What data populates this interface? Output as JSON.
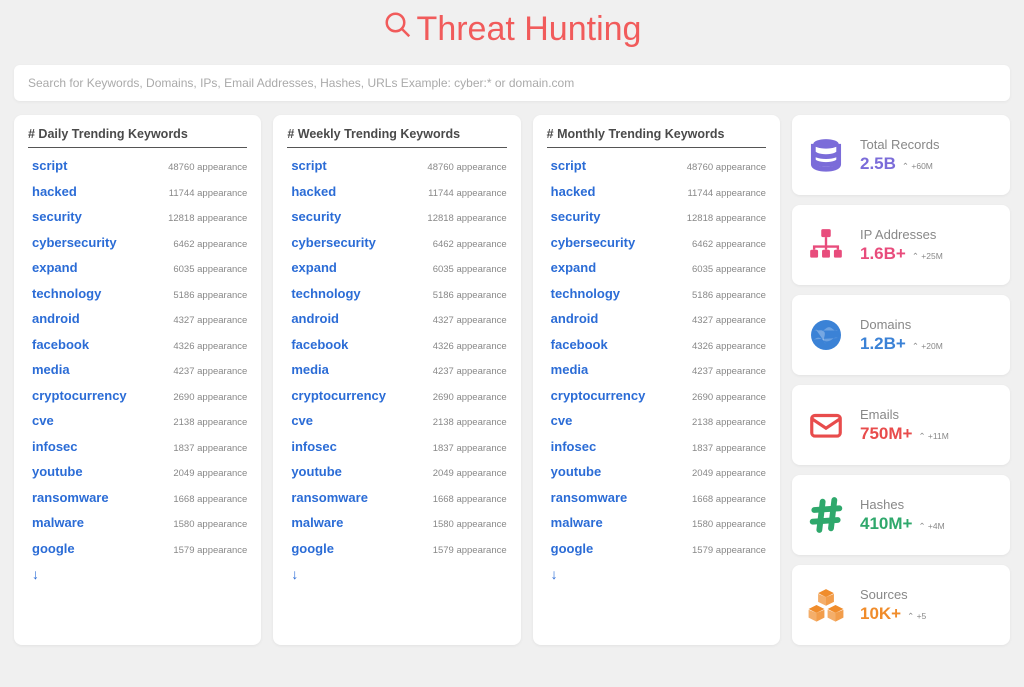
{
  "header": {
    "title": "Threat Hunting"
  },
  "search": {
    "placeholder": "Search for Keywords, Domains, IPs, Email Addresses, Hashes, URLs Example: cyber:* or domain.com"
  },
  "panels": [
    {
      "title": "# Daily Trending Keywords"
    },
    {
      "title": "# Weekly Trending Keywords"
    },
    {
      "title": "# Monthly Trending Keywords"
    }
  ],
  "keywords": [
    {
      "name": "script",
      "count": "48760 appearance"
    },
    {
      "name": "hacked",
      "count": "11744 appearance"
    },
    {
      "name": "security",
      "count": "12818 appearance"
    },
    {
      "name": "cybersecurity",
      "count": "6462 appearance"
    },
    {
      "name": "expand",
      "count": "6035 appearance"
    },
    {
      "name": "technology",
      "count": "5186 appearance"
    },
    {
      "name": "android",
      "count": "4327 appearance"
    },
    {
      "name": "facebook",
      "count": "4326 appearance"
    },
    {
      "name": "media",
      "count": "4237 appearance"
    },
    {
      "name": "cryptocurrency",
      "count": "2690 appearance"
    },
    {
      "name": "cve",
      "count": "2138 appearance"
    },
    {
      "name": "infosec",
      "count": "1837 appearance"
    },
    {
      "name": "youtube",
      "count": "2049 appearance"
    },
    {
      "name": "ransomware",
      "count": "1668 appearance"
    },
    {
      "name": "malware",
      "count": "1580 appearance"
    },
    {
      "name": "google",
      "count": "1579 appearance"
    }
  ],
  "more_arrow": "↓",
  "stats": [
    {
      "label": "Total Records",
      "value": "2.5B",
      "delta": "⌃ +60M",
      "icon": "database",
      "color": "c-purple"
    },
    {
      "label": "IP Addresses",
      "value": "1.6B+",
      "delta": "⌃ +25M",
      "icon": "sitemap",
      "color": "c-pink"
    },
    {
      "label": "Domains",
      "value": "1.2B+",
      "delta": "⌃ +20M",
      "icon": "globe",
      "color": "c-blue"
    },
    {
      "label": "Emails",
      "value": "750M+",
      "delta": "⌃ +11M",
      "icon": "envelope",
      "color": "c-red"
    },
    {
      "label": "Hashes",
      "value": "410M+",
      "delta": "⌃ +4M",
      "icon": "hash",
      "color": "c-green"
    },
    {
      "label": "Sources",
      "value": "10K+",
      "delta": "⌃ +5",
      "icon": "cubes",
      "color": "c-orange"
    }
  ]
}
